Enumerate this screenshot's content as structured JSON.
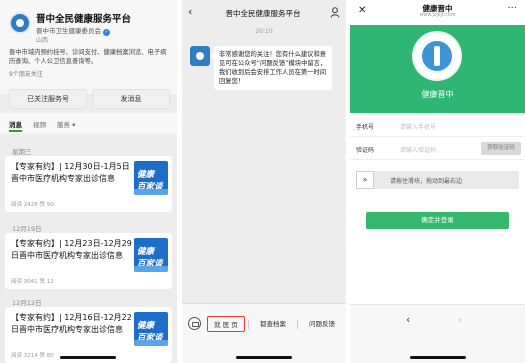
{
  "panel1": {
    "account_name": "晋中全民健康服务平台",
    "org": "晋中市卫生健康委员会",
    "region": "山西",
    "description": "晋中市域内预约挂号、诊间支付、健康档案浏览、电子病历查询、个人公卫信息查询等。",
    "friends_followed": "9个朋友关注",
    "btn_followed": "已关注服务号",
    "btn_message": "发消息",
    "tabs": [
      "消息",
      "视频",
      "服务 ▾"
    ],
    "thumb_text_1": "健康",
    "thumb_text_2": "百家谈",
    "posts": [
      {
        "date": "星期三",
        "title": "【专家有约】| 12月30日-1月5日晋中市医疗机构专家出诊信息",
        "meta": "阅读 2428   赞 90"
      },
      {
        "date": "12月19日",
        "title": "【专家有约】| 12月23日-12月29日晋中市医疗机构专家出诊信息",
        "meta": "阅读 3041   赞 12"
      },
      {
        "date": "12月12日",
        "title": "【专家有约】| 12月16日-12月22日晋中市医疗机构专家出诊信息",
        "meta": "阅读 3214   赞 80"
      }
    ]
  },
  "panel2": {
    "back": "‹",
    "title": "晋中全民健康服务平台",
    "time": "20:10",
    "message": "非常感谢您的关注！您有什么建议和意见可在公众号“问题反馈”模块中留言，我们收到后会安排工作人员在第一时间回复您！",
    "menu": [
      "就 医 页",
      "都查档案",
      "问题反馈"
    ]
  },
  "panel3": {
    "close": "✕",
    "title": "健康晋中",
    "url": "www.jzjkjt.com",
    "more": "···",
    "hero_name": "健康晋中",
    "phone_label": "手机号",
    "phone_placeholder": "请输入手机号",
    "code_label": "验证码",
    "code_placeholder": "请输入验证码",
    "get_code": "获取验证码",
    "slider_text": "请按住滑块，拖动到最右边",
    "slider_handle": "»",
    "submit": "确定并登录",
    "nav_back": "‹",
    "nav_forward": "›"
  },
  "colors": {
    "wechat_green": "#1aad19",
    "hero_green": "#2fb673",
    "button_green": "#33b86c",
    "menu_highlight": "#e53935",
    "thumb_blue": "#1d6ec8"
  }
}
